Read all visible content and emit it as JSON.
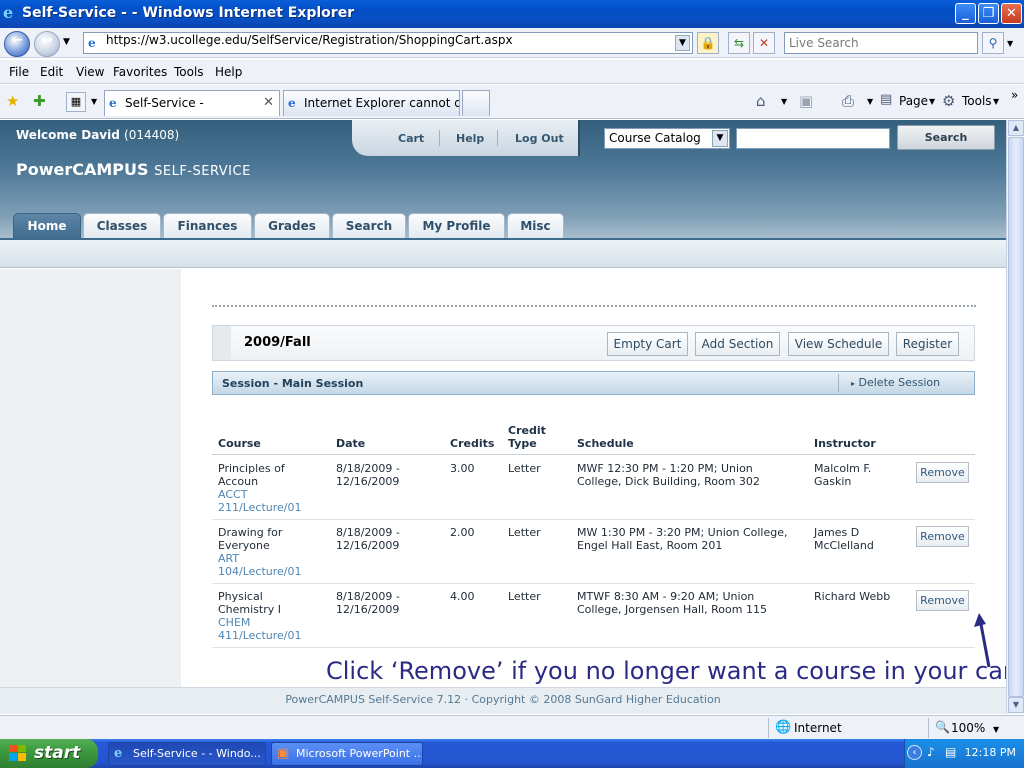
{
  "window": {
    "title": "Self-Service - - Windows Internet Explorer"
  },
  "address_bar": {
    "url": "https://w3.ucollege.edu/SelfService/Registration/ShoppingCart.aspx",
    "search_placeholder": "Live Search"
  },
  "menu": [
    "File",
    "Edit",
    "View",
    "Favorites",
    "Tools",
    "Help"
  ],
  "browser_tabs": [
    {
      "label": "Self-Service -"
    },
    {
      "label": "Internet Explorer cannot dis..."
    }
  ],
  "toolbar": {
    "page_label": "Page",
    "tools_label": "Tools"
  },
  "site": {
    "welcome_name": "Welcome David",
    "welcome_id": "(014408)",
    "logo_main": "PowerCAMPUS",
    "logo_sub": "SELF-SERVICE",
    "top_links": [
      "Cart",
      "Help",
      "Log Out"
    ],
    "catalog_select": "Course Catalog",
    "search_button": "Search",
    "nav_tabs": [
      "Home",
      "Classes",
      "Finances",
      "Grades",
      "Search",
      "My Profile",
      "Misc"
    ],
    "active_tab": "Home",
    "footer": "PowerCAMPUS Self-Service 7.12 · Copyright © 2008 SunGard Higher Education"
  },
  "cart": {
    "term": "2009/Fall",
    "buttons": [
      "Empty Cart",
      "Add Section",
      "View Schedule",
      "Register"
    ],
    "session_title": "Session - Main Session",
    "delete_session": "Delete Session",
    "columns": {
      "course": "Course",
      "date": "Date",
      "credits": "Credits",
      "credit_type_1": "Credit",
      "credit_type_2": "Type",
      "schedule": "Schedule",
      "instructor": "Instructor"
    },
    "rows": [
      {
        "title_1": "Principles of",
        "title_2": "Accoun",
        "code_1": "ACCT",
        "code_2": "211/Lecture/01",
        "date_1": "8/18/2009 -",
        "date_2": "12/16/2009",
        "credits": "3.00",
        "credit_type": "Letter",
        "schedule_1": "MWF 12:30 PM - 1:20 PM; Union",
        "schedule_2": "College, Dick Building, Room 302",
        "instructor_1": "Malcolm F.",
        "instructor_2": "Gaskin",
        "remove": "Remove"
      },
      {
        "title_1": "Drawing for",
        "title_2": "Everyone",
        "code_1": "ART",
        "code_2": "104/Lecture/01",
        "date_1": "8/18/2009 -",
        "date_2": "12/16/2009",
        "credits": "2.00",
        "credit_type": "Letter",
        "schedule_1": "MW 1:30 PM - 3:20 PM; Union College,",
        "schedule_2": "Engel Hall East, Room 201",
        "instructor_1": "James D",
        "instructor_2": "McClelland",
        "remove": "Remove"
      },
      {
        "title_1": "Physical",
        "title_2": "Chemistry I",
        "code_1": "CHEM",
        "code_2": "411/Lecture/01",
        "date_1": "8/18/2009 -",
        "date_2": "12/16/2009",
        "credits": "4.00",
        "credit_type": "Letter",
        "schedule_1": "MTWF 8:30 AM - 9:20 AM; Union",
        "schedule_2": "College, Jorgensen Hall, Room 115",
        "instructor_1": "Richard Webb",
        "instructor_2": "",
        "remove": "Remove"
      }
    ]
  },
  "callout": "Click ‘Remove’ if you no longer want a course in your cart.",
  "status_bar": {
    "zone": "Internet",
    "zoom": "100%"
  },
  "taskbar": {
    "start": "start",
    "tasks": [
      "Self-Service - - Windo...",
      "Microsoft PowerPoint ..."
    ],
    "clock": "12:18 PM"
  },
  "colors": {
    "accent": "#3f6b8e",
    "link": "#4f86b3",
    "callout": "#2b2b86"
  }
}
